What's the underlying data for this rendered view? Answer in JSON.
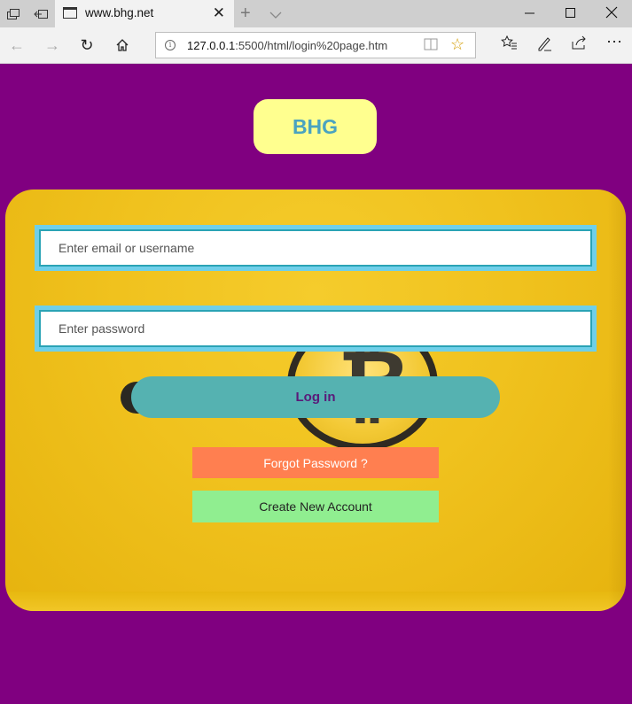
{
  "browser": {
    "tab_title": "www.bhg.net",
    "address_host": "127.0.0.1",
    "address_path": ":5500/html/login%20page.htm",
    "icons": [
      "tab-actions-icon",
      "set-tabs-aside-icon",
      "page-icon",
      "close-icon",
      "new-tab-icon",
      "tab-preview-icon",
      "minimize-icon",
      "maximize-icon",
      "window-close-icon",
      "back-icon",
      "forward-icon",
      "refresh-icon",
      "home-icon",
      "info-icon",
      "reading-view-icon",
      "favorite-star-icon",
      "favorites-icon",
      "pen-icon",
      "share-icon",
      "more-icon"
    ]
  },
  "page": {
    "logo": "BHG",
    "email_placeholder": "Enter email or username",
    "password_placeholder": "Enter password",
    "login_label": "Log in",
    "forgot_label": "Forgot Password ?",
    "create_label": "Create New Account"
  },
  "colors": {
    "page_bg": "#800080",
    "logo_bg": "#ffff8f",
    "logo_text": "#4aa3c0",
    "card_bg": "#f0c21e",
    "input_border": "#6fcfe9",
    "login_bg": "#55b2b1",
    "login_text": "#5a1a79",
    "forgot_bg": "#ff7f50",
    "create_bg": "#90ee90"
  }
}
